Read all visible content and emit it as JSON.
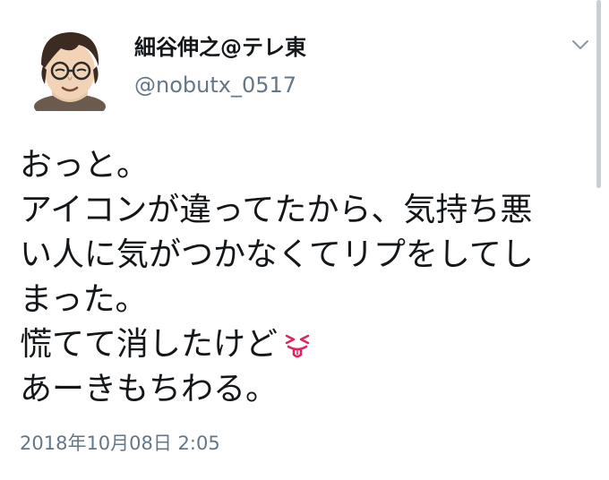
{
  "user": {
    "display_name": "細谷伸之@テレ東",
    "handle": "@nobutx_0517",
    "avatar_icon": "user-avatar-illustration"
  },
  "menu_icon": "chevron-down-icon",
  "tweet": {
    "lines": [
      "おっと。",
      "アイコンが違ってたから、気持ち悪",
      "い人に気がつかなくてリプをしてし",
      "まった。",
      "慌てて消したけど",
      "あーきもちわる。"
    ],
    "emoji": "squinting-face-with-tongue-emoji"
  },
  "timestamp": "2018年10月08日 2:05",
  "colors": {
    "text": "#14171a",
    "secondary": "#657786",
    "emoji_red": "#e0245e"
  }
}
